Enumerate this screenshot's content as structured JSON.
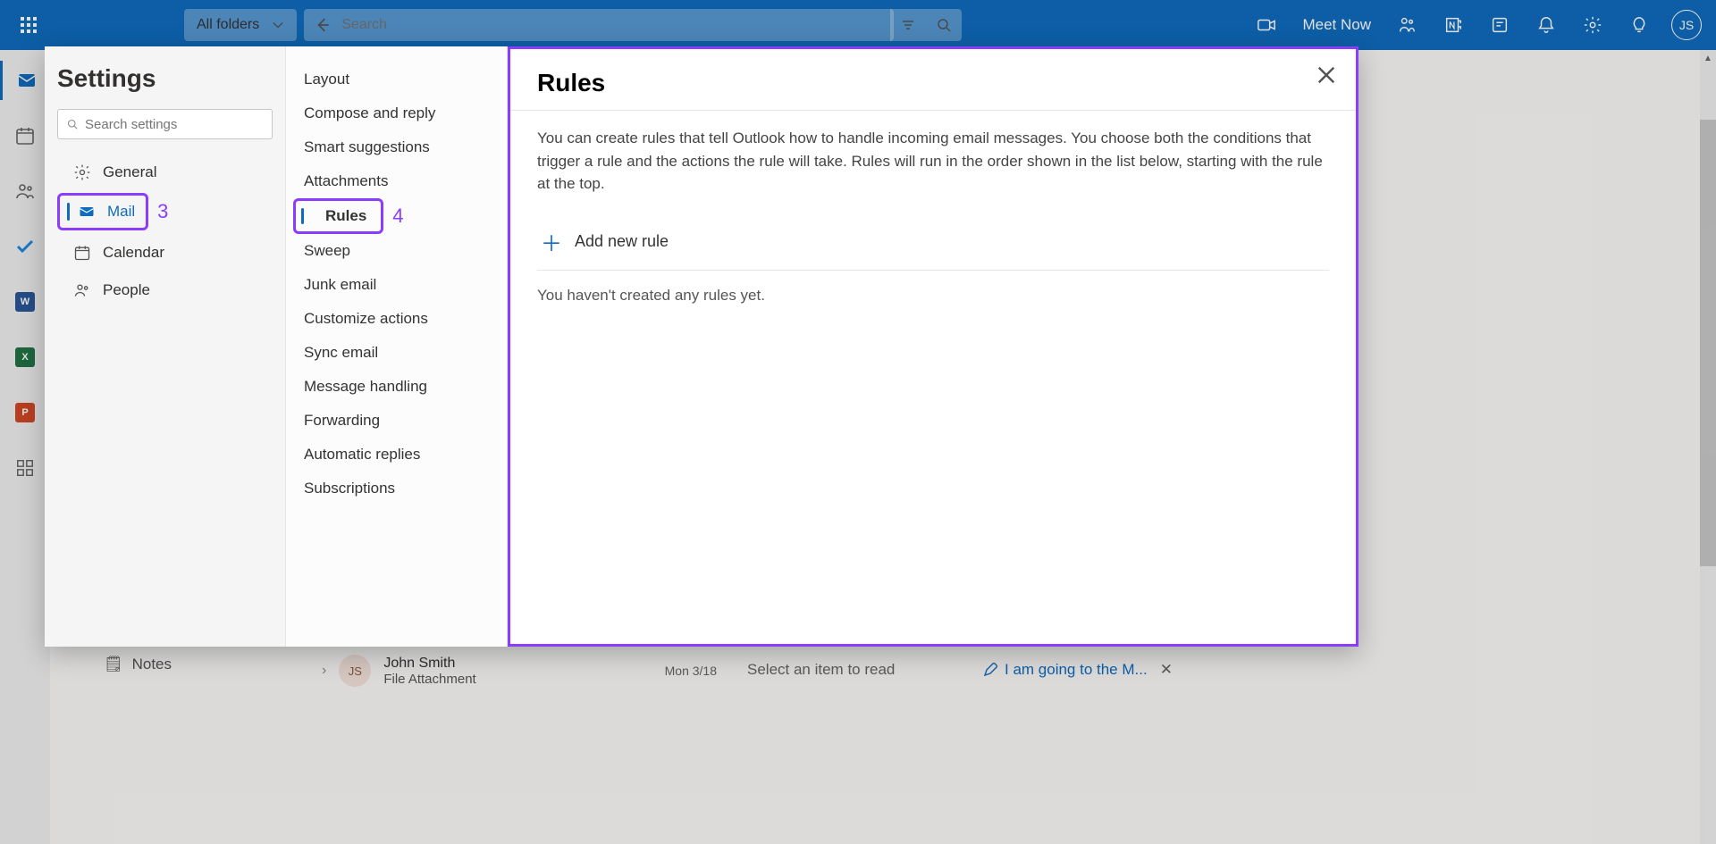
{
  "header": {
    "folder_label": "All folders",
    "search_placeholder": "Search",
    "meet_now": "Meet Now",
    "avatar_initials": "JS"
  },
  "underlying": {
    "notes_label": "Notes",
    "row_initials": "JS",
    "row_name": "John Smith",
    "row_subject": "File Attachment",
    "row_date": "Mon 3/18",
    "read_pane": "Select an item to read",
    "draft_text": "I am going to the M..."
  },
  "settings": {
    "title": "Settings",
    "search_placeholder": "Search settings",
    "categories": [
      {
        "label": "General",
        "active": false
      },
      {
        "label": "Mail",
        "active": true
      },
      {
        "label": "Calendar",
        "active": false
      },
      {
        "label": "People",
        "active": false
      }
    ],
    "callout_mail": "3",
    "subcategories": [
      "Layout",
      "Compose and reply",
      "Smart suggestions",
      "Attachments",
      "Rules",
      "Sweep",
      "Junk email",
      "Customize actions",
      "Sync email",
      "Message handling",
      "Forwarding",
      "Automatic replies",
      "Subscriptions"
    ],
    "sub_active_index": 4,
    "callout_rules": "4",
    "panel": {
      "title": "Rules",
      "description": "You can create rules that tell Outlook how to handle incoming email messages. You choose both the conditions that trigger a rule and the actions the rule will take. Rules will run in the order shown in the list below, starting with the rule at the top.",
      "add_label": "Add new rule",
      "empty": "You haven't created any rules yet."
    }
  }
}
